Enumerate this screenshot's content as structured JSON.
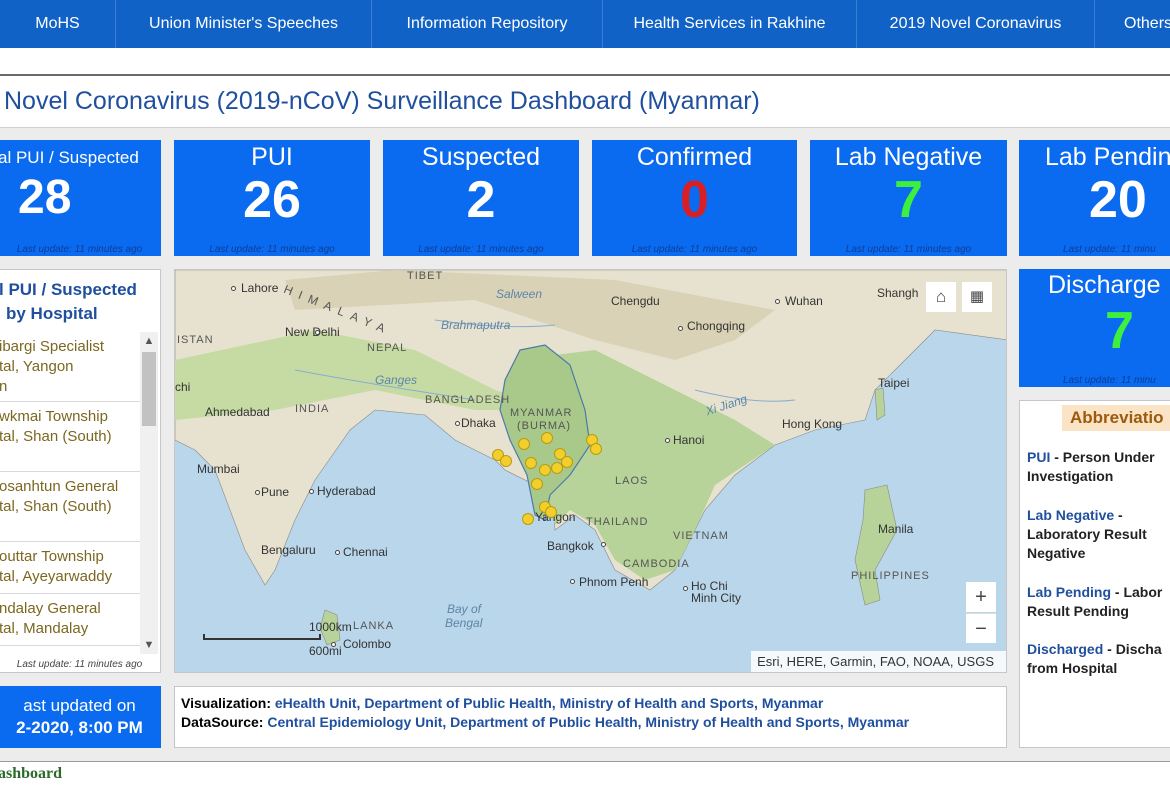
{
  "nav": {
    "items": [
      "MoHS",
      "Union Minister's Speeches",
      "Information Repository",
      "Health Services in Rakhine",
      "2019 Novel Coronavirus",
      "Others"
    ]
  },
  "dashboard": {
    "title": "Novel Coronavirus (2019-nCoV) Surveillance Dashboard (Myanmar)"
  },
  "cards": {
    "total": {
      "label": "al PUI / Suspected",
      "value": "28",
      "update": "Last update: 11 minutes ago"
    },
    "pui": {
      "label": "PUI",
      "value": "26",
      "update": "Last update: 11 minutes ago"
    },
    "suspected": {
      "label": "Suspected",
      "value": "2",
      "update": "Last update: 11 minutes ago"
    },
    "confirmed": {
      "label": "Confirmed",
      "value": "0",
      "update": "Last update: 11 minutes ago"
    },
    "lab_negative": {
      "label": "Lab Negative",
      "value": "7",
      "update": "Last update: 11 minutes ago"
    },
    "lab_pending": {
      "label": "Lab Pendin",
      "value": "20",
      "update": "Last update: 11 minu"
    },
    "discharged": {
      "label": "Discharge",
      "value": "7",
      "update": "Last update: 11 minu"
    }
  },
  "colors": {
    "card_blue": "#0b6bf0",
    "confirmed_red": "#d81f26",
    "negative_green": "#3ef03e",
    "title_blue": "#1f4f9e"
  },
  "hospital_list": {
    "title_line1": "l PUI / Suspected",
    "title_line2": "by Hospital",
    "items": [
      {
        "line1": "ibargi Specialist",
        "line2": "tal, Yangon",
        "line3": "n"
      },
      {
        "line1": "wkmai Township",
        "line2": "tal, Shan (South)",
        "line3": ""
      },
      {
        "line1": "osanhtun General",
        "line2": "tal, Shan (South)",
        "line3": ""
      },
      {
        "line1": "outtar Township",
        "line2": "tal, Ayeyarwaddy",
        "line3": ""
      },
      {
        "line1": "ndalay General",
        "line2": "tal, Mandalay",
        "line3": ""
      }
    ],
    "update": "Last update: 11 minutes ago"
  },
  "last_updated": {
    "line1": "ast updated on",
    "line2": "2-2020, 8:00 PM"
  },
  "map": {
    "labels": {
      "tibet": "TIBET",
      "himalaya": "HIMALAYA",
      "lahore": "Lahore",
      "new_delhi": "New Delhi",
      "nepal": "NEPAL",
      "istan": "ISTAN",
      "chi": "chi",
      "ganges": "Ganges",
      "brahmaputra": "Brahmaputra",
      "salween": "Salween",
      "chengdu": "Chengdu",
      "wuhan": "Wuhan",
      "shanghai": "Shangh",
      "chongqing": "Chongqing",
      "taipei": "Taipei",
      "ahmedabad": "Ahmedabad",
      "india": "INDIA",
      "bangladesh": "BANGLADESH",
      "dhaka": "Dhaka",
      "myanmar": "MYANMAR",
      "burma": "(BURMA)",
      "hanoi": "Hanoi",
      "xijiang": "Xi Jiang",
      "hongkong": "Hong Kong",
      "mumbai": "Mumbai",
      "pune": "Pune",
      "hyderabad": "Hyderabad",
      "laos": "LAOS",
      "yangon": "Yangon",
      "thailand": "THAILAND",
      "vietnam": "VIETNAM",
      "bengaluru": "Bengaluru",
      "chennai": "Chennai",
      "bangkok": "Bangkok",
      "cambodia": "CAMBODIA",
      "manila": "Manila",
      "phnompenh": "Phnom Penh",
      "hochiminh1": "Ho Chi",
      "hochiminh2": "Minh City",
      "philippines": "PHILIPPINES",
      "bay1": "Bay of",
      "bay2": "Bengal",
      "lanka": "LANKA",
      "colombo": "Colombo"
    },
    "scale_km": "1000km",
    "scale_mi": "600mi",
    "zoom_in": "+",
    "zoom_out": "−",
    "attribution": "Esri, HERE, Garmin, FAO, NOAA, USGS",
    "home_icon": "home-icon",
    "qr_icon": "qr-code-icon"
  },
  "credit": {
    "vis_key": "Visualization:",
    "vis_val": "eHealth Unit, Department of Public Health, Ministry of Health and Sports, Myanmar",
    "src_key": "DataSource:",
    "src_val": "Central Epidemiology Unit, Department of Public Health, Ministry of Health and Sports, Myanmar"
  },
  "abbreviations": {
    "heading": "Abbreviatio",
    "entries": [
      {
        "term": "PUI",
        "rest1": " - Person Under",
        "rest2": "Investigation",
        "rest3": ""
      },
      {
        "term": "Lab Negative",
        "rest1": " -",
        "rest2": "Laboratory Result",
        "rest3": "Negative"
      },
      {
        "term": "Lab Pending",
        "rest1": " - Labor",
        "rest2": "Result Pending",
        "rest3": ""
      },
      {
        "term": "Discharged",
        "rest1": " - Discha",
        "rest2": "from Hospital",
        "rest3": ""
      }
    ]
  },
  "footer": {
    "link": "ashboard"
  }
}
